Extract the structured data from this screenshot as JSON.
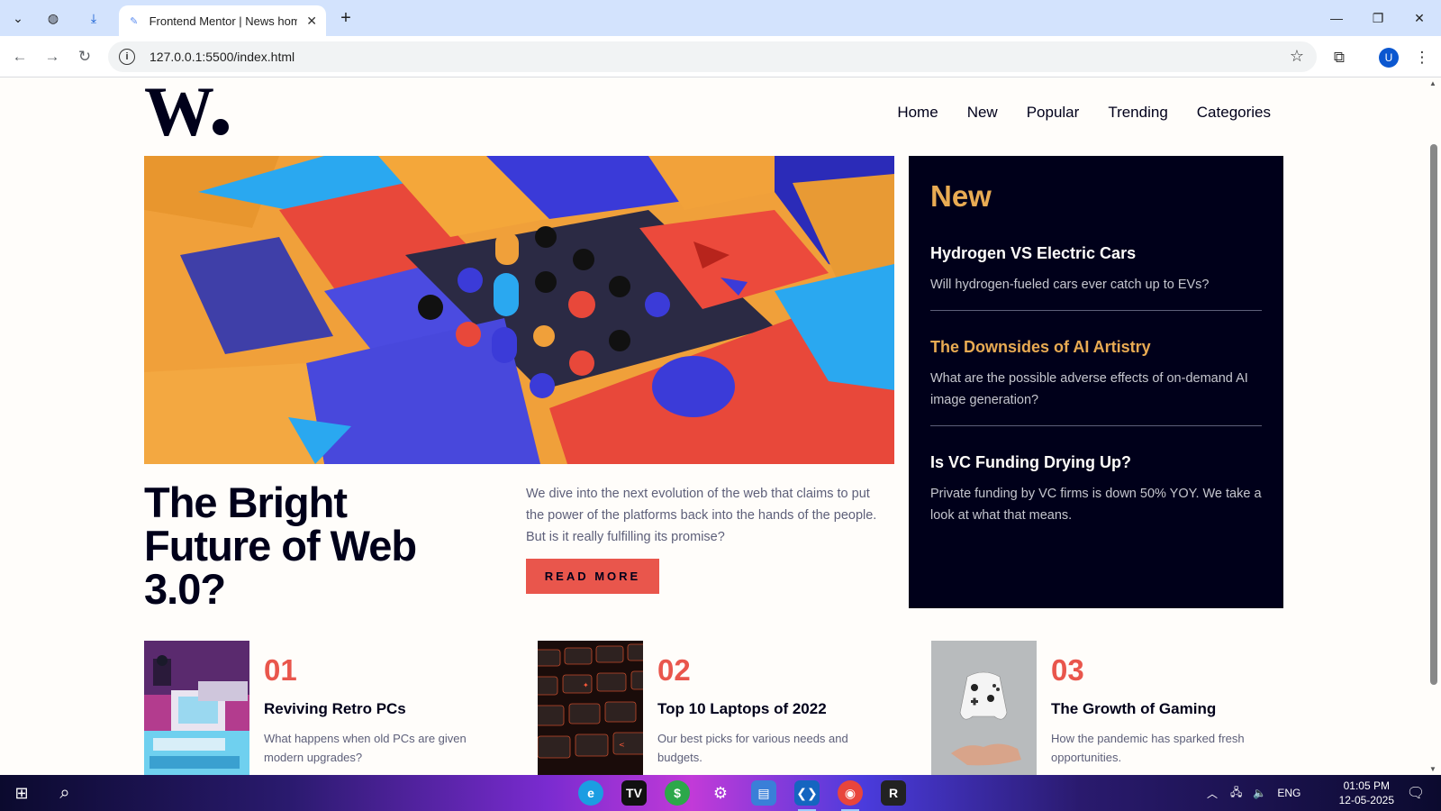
{
  "browser": {
    "tab_title": "Frontend Mentor | News homepage",
    "url": "127.0.0.1:5500/index.html",
    "profile_initial": "U"
  },
  "site": {
    "logo": "W",
    "nav": [
      "Home",
      "New",
      "Popular",
      "Trending",
      "Categories"
    ]
  },
  "hero": {
    "title": "The Bright Future of Web 3.0?",
    "description": "We dive into the next evolution of the web that claims to put the power of the platforms back into the hands of the people. But is it really fulfilling its promise?",
    "button": "READ MORE"
  },
  "new_panel": {
    "heading": "New",
    "items": [
      {
        "title": "Hydrogen VS Electric Cars",
        "desc": "Will hydrogen-fueled cars ever catch up to EVs?"
      },
      {
        "title": "The Downsides of AI Artistry",
        "desc": "What are the possible adverse effects of on-demand AI image generation?"
      },
      {
        "title": "Is VC Funding Drying Up?",
        "desc": "Private funding by VC firms is down 50% YOY. We take a look at what that means."
      }
    ]
  },
  "cards": [
    {
      "num": "01",
      "title": "Reviving Retro PCs",
      "desc": "What happens when old PCs are given modern upgrades?"
    },
    {
      "num": "02",
      "title": "Top 10 Laptops of 2022",
      "desc": "Our best picks for various needs and budgets."
    },
    {
      "num": "03",
      "title": "The Growth of Gaming",
      "desc": "How the pandemic has sparked fresh opportunities."
    }
  ],
  "taskbar": {
    "language": "ENG",
    "time": "01:05 PM",
    "date": "12-05-2025"
  },
  "colors": {
    "accent_red": "#e9564c",
    "accent_orange": "#e9ab53",
    "dark": "#00001a",
    "off_white": "#fffdfa"
  }
}
